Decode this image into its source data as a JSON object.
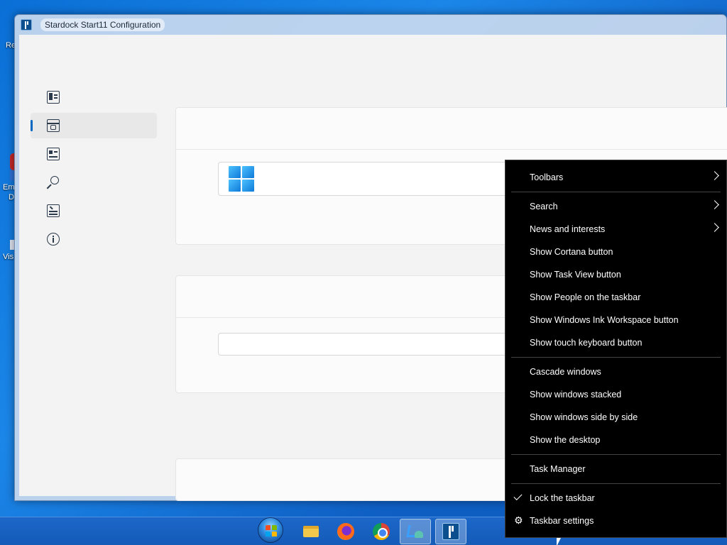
{
  "desktop": {
    "fragments": [
      "Re",
      "Em",
      "D",
      "Vis"
    ]
  },
  "window": {
    "title": "Stardock Start11 Configuration"
  },
  "nav": {
    "items": [
      {
        "icon": "start-menu-icon"
      },
      {
        "icon": "taskbar-icon",
        "selected": true
      },
      {
        "icon": "control-panel-icon"
      },
      {
        "icon": "search-icon"
      },
      {
        "icon": "keyboard-icon"
      },
      {
        "icon": "info-icon"
      }
    ]
  },
  "context_menu": {
    "items": {
      "toolbars": "Toolbars",
      "search": "Search",
      "news": "News and interests",
      "cortana": "Show Cortana button",
      "task_view": "Show Task View button",
      "people": "Show People on the taskbar",
      "ink": "Show Windows Ink Workspace button",
      "touch_keyboard": "Show touch keyboard button",
      "cascade": "Cascade windows",
      "stacked": "Show windows stacked",
      "side_by_side": "Show windows side by side",
      "desktop": "Show the desktop",
      "task_manager": "Task Manager",
      "lock": "Lock the taskbar",
      "settings": "Taskbar settings"
    },
    "lock_checked": true
  },
  "taskbar": {
    "buttons": [
      "start-orb",
      "file-explorer",
      "firefox",
      "chrome",
      "downloads",
      "start11"
    ],
    "active": "start11"
  },
  "colors": {
    "accent": "#0067c0",
    "menu_background": "#000000",
    "taskbar": "#1a62c4"
  }
}
